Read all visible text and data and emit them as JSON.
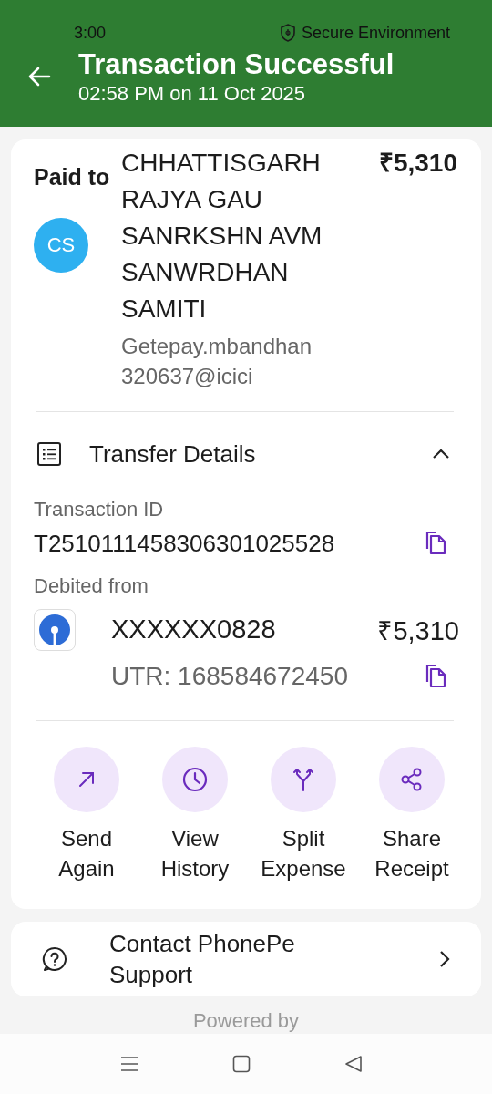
{
  "status_bar": {
    "time": "3:00",
    "secure_label": "Secure Environment"
  },
  "header": {
    "title": "Transaction Successful",
    "subtitle": "02:58 PM on 11 Oct 2025"
  },
  "payee": {
    "label": "Paid to",
    "initials": "CS",
    "name": "CHHATTISGARH RAJYA GAU SANRKSHN AVM SANWRDHAN SAMITI",
    "amount": "₹5,310",
    "vpa": "Getepay.mbandhan320637@icici"
  },
  "transfer_details": {
    "title": "Transfer Details",
    "expanded": true,
    "transaction_id": {
      "label": "Transaction ID",
      "value": "T2510111458306301025528"
    },
    "debited_from": {
      "label": "Debited from",
      "account": "XXXXXX0828",
      "amount": "₹5,310",
      "utr": "UTR: 168584672450"
    }
  },
  "actions": [
    {
      "kind": "send",
      "label": "Send Again"
    },
    {
      "kind": "history",
      "label": "View History"
    },
    {
      "kind": "split",
      "label": "Split Expense"
    },
    {
      "kind": "share",
      "label": "Share Receipt"
    }
  ],
  "support": {
    "label": "Contact PhonePe Support"
  },
  "footer": {
    "powered_by": "Powered by"
  }
}
